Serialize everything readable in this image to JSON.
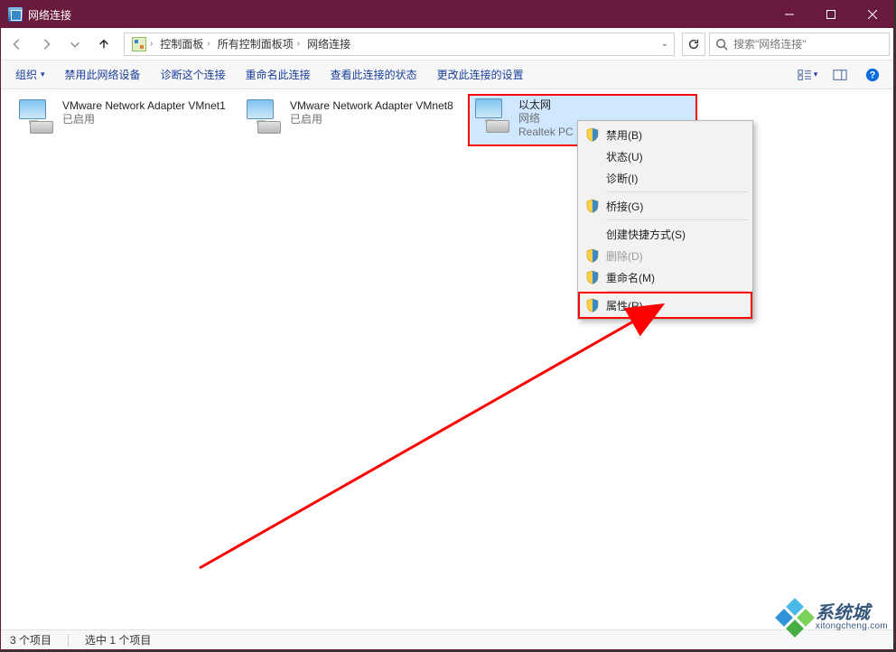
{
  "window": {
    "title": "网络连接",
    "minimize_aria": "Minimize",
    "maximize_aria": "Maximize",
    "close_aria": "Close"
  },
  "breadcrumb": {
    "items": [
      "控制面板",
      "所有控制面板项",
      "网络连接"
    ]
  },
  "search": {
    "placeholder": "搜索\"网络连接\""
  },
  "commands": {
    "organize": "组织",
    "items": [
      "禁用此网络设备",
      "诊断这个连接",
      "重命名此连接",
      "查看此连接的状态",
      "更改此连接的设置"
    ]
  },
  "adapters": [
    {
      "name": "VMware Network Adapter VMnet1",
      "status": "已启用",
      "detail": ""
    },
    {
      "name": "VMware Network Adapter VMnet8",
      "status": "已启用",
      "detail": ""
    },
    {
      "name": "以太网",
      "status": "网络",
      "detail": "Realtek PC"
    }
  ],
  "context_menu": {
    "items": [
      {
        "label": "禁用(B)",
        "shield": true,
        "enabled": true
      },
      {
        "label": "状态(U)",
        "shield": false,
        "enabled": true
      },
      {
        "label": "诊断(I)",
        "shield": false,
        "enabled": true
      },
      {
        "sep": true
      },
      {
        "label": "桥接(G)",
        "shield": true,
        "enabled": true
      },
      {
        "sep": true
      },
      {
        "label": "创建快捷方式(S)",
        "shield": false,
        "enabled": true
      },
      {
        "label": "删除(D)",
        "shield": true,
        "enabled": false
      },
      {
        "label": "重命名(M)",
        "shield": true,
        "enabled": true
      },
      {
        "sep": true
      },
      {
        "label": "属性(R)",
        "shield": true,
        "enabled": true,
        "highlight": true
      }
    ]
  },
  "statusbar": {
    "count": "3 个项目",
    "selection": "选中 1 个项目"
  },
  "watermark": {
    "cn": "系统城",
    "en": "xitongcheng.com"
  },
  "colors": {
    "titlebar": "#6a1b3d",
    "highlight_red": "#ff0000",
    "selection_bg": "#cfe8ff"
  }
}
